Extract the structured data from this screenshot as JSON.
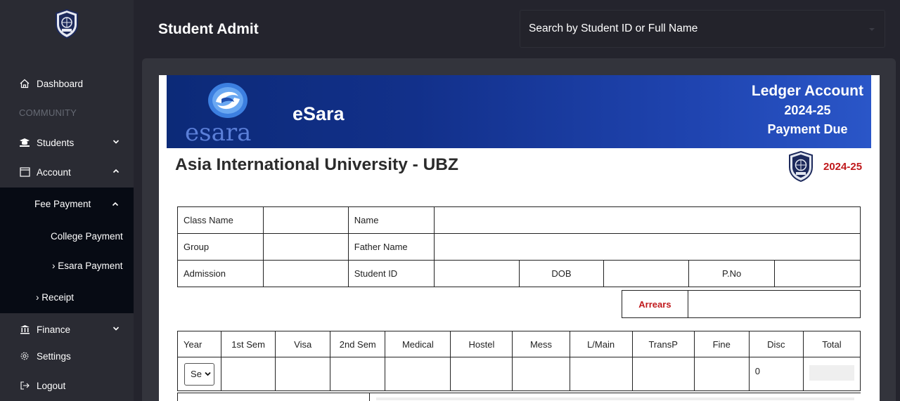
{
  "header": {
    "title": "Student Admit",
    "search_placeholder": "Search by Student ID or Full Name"
  },
  "sidebar": {
    "dashboard": "Dashboard",
    "section_community": "COMMUNITY",
    "students": "Students",
    "account": "Account",
    "fee_payment": "Fee Payment",
    "college_payment": "College Payment",
    "esara_payment": "› Esara Payment",
    "receipt": "› Receipt",
    "finance": "Finance",
    "settings": "Settings",
    "logout": "Logout"
  },
  "banner": {
    "brand": "eSara",
    "brand_script_e": "e",
    "brand_script_rest": "sara",
    "ledger_title": "Ledger Account",
    "ledger_year": "2024-25",
    "ledger_sub": "Payment Due"
  },
  "university": {
    "name": "Asia International University - UBZ",
    "year": "2024-25"
  },
  "info_table": {
    "class_name": "Class Name",
    "name": "Name",
    "group": "Group",
    "father_name": "Father Name",
    "admission": "Admission",
    "student_id": "Student ID",
    "dob": "DOB",
    "pno": "P.No",
    "arrears": "Arrears"
  },
  "fee_table": {
    "headers": [
      "Year",
      "1st Sem",
      "Visa",
      "2nd Sem",
      "Medical",
      "Hostel",
      "Mess",
      "L/Main",
      "TransP",
      "Fine",
      "Disc",
      "Total"
    ],
    "year_select": "Se",
    "disc_value": "0"
  },
  "colors": {
    "accent_red": "#c0191c",
    "banner_blue": "#12308a",
    "sidebar_bg": "#2a2b33"
  }
}
